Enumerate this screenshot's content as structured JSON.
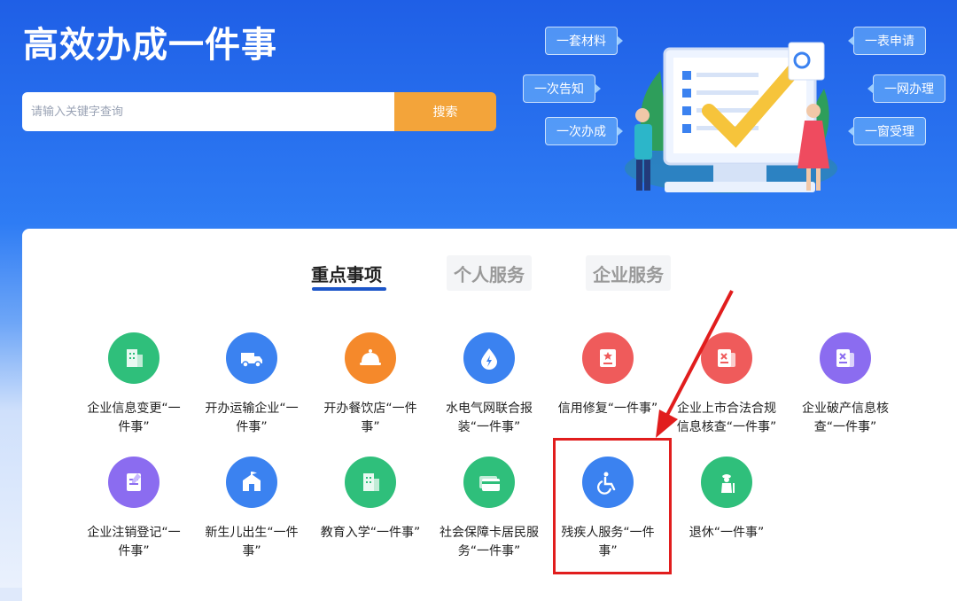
{
  "hero": {
    "title": "高效办成一件事",
    "search": {
      "placeholder": "请输入关键字查询",
      "button_label": "搜索"
    },
    "tags": [
      "一套材料",
      "一次告知",
      "一次办成",
      "一表申请",
      "一网办理",
      "一窗受理"
    ]
  },
  "tabs": [
    {
      "label": "重点事项",
      "active": true
    },
    {
      "label": "个人服务",
      "active": false
    },
    {
      "label": "企业服务",
      "active": false
    }
  ],
  "services_row1": [
    {
      "line1": "企业信息变更“一",
      "line2": "件事”",
      "icon": "building-icon",
      "color": "#2fbf7b"
    },
    {
      "line1": "开办运输企业“一",
      "line2": "件事”",
      "icon": "truck-icon",
      "color": "#3b82f0"
    },
    {
      "line1": "开办餐饮店“一件",
      "line2": "事”",
      "icon": "food-cloche-icon",
      "color": "#f5892b"
    },
    {
      "line1": "水电气网联合报",
      "line2": "装“一件事”",
      "icon": "water-drop-icon",
      "color": "#3b82f0"
    },
    {
      "line1": "信用修复“一件事”",
      "line2": "",
      "icon": "certificate-icon",
      "color": "#ef5b5b"
    },
    {
      "line1": "企业上市合法合规",
      "line2": "信息核查“一件事”",
      "icon": "document-x-icon",
      "color": "#ef5b5b"
    },
    {
      "line1": "企业破产信息核",
      "line2": "查“一件事”",
      "icon": "document-x-icon",
      "color": "#8b6cf0"
    }
  ],
  "services_row2": [
    {
      "line1": "企业注销登记“一",
      "line2": "件事”",
      "icon": "document-edit-icon",
      "color": "#8b6cf0"
    },
    {
      "line1": "新生儿出生“一件",
      "line2": "事”",
      "icon": "school-icon",
      "color": "#3b82f0"
    },
    {
      "line1": "教育入学“一件事”",
      "line2": "",
      "icon": "building-icon",
      "color": "#2fbf7b"
    },
    {
      "line1": "社会保障卡居民服",
      "line2": "务“一件事”",
      "icon": "card-icon",
      "color": "#2fbf7b"
    },
    {
      "line1": "残疾人服务“一件",
      "line2": "事”",
      "icon": "wheelchair-icon",
      "color": "#3b82f0"
    },
    {
      "line1": "退休“一件事”",
      "line2": "",
      "icon": "elderly-icon",
      "color": "#2fbf7b"
    }
  ]
}
